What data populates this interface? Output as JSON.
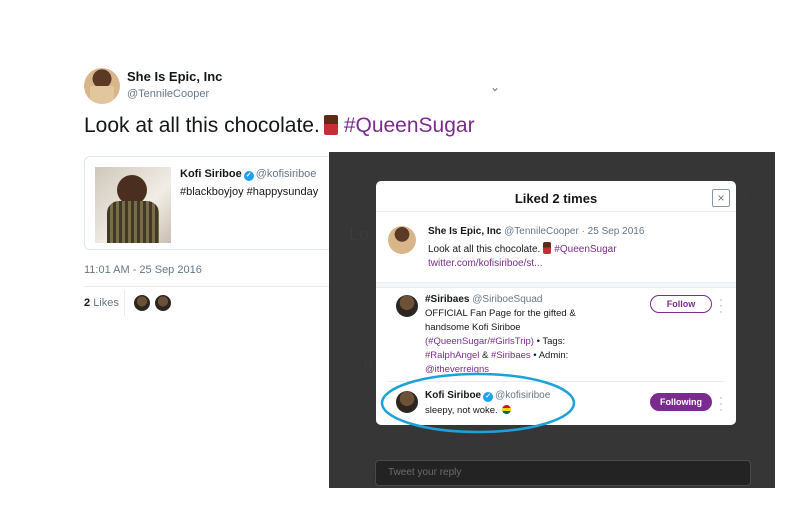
{
  "tweet": {
    "author_name": "She Is Epic, Inc",
    "author_handle": "@TennileCooper",
    "text": "Look at all this chocolate.",
    "hashtag": "#QueenSugar",
    "quote": {
      "name": "Kofi Siriboe",
      "handle": "@kofisiriboe",
      "text": "#blackboyjoy #happysunday"
    },
    "timestamp": "11:01 AM - 25 Sep 2016",
    "likes_count": "2",
    "likes_label": "Likes"
  },
  "overlay": {
    "reply_placeholder": "Tweet your reply"
  },
  "modal": {
    "title": "Liked 2 times",
    "close": "×",
    "original": {
      "name": "She Is Epic, Inc",
      "meta": "@TennileCooper · 25 Sep 2016",
      "text": "Look at all this chocolate.",
      "hashtag": "#QueenSugar",
      "link": "twitter.com/kofisiriboe/st..."
    },
    "likers": [
      {
        "name": "#Siribaes",
        "handle": "@SiriboeSquad",
        "bio_1": "OFFICIAL Fan Page for the gifted &",
        "bio_2": "handsome Kofi Siriboe",
        "bio_3_link": "(#QueenSugar/#GirlsTrip)",
        "bio_3_rest": " • Tags:",
        "bio_4_a": "#RalphAngel",
        "bio_4_mid": " & ",
        "bio_4_b": "#Siribaes",
        "bio_4_rest": " • Admin:",
        "bio_5": "@itheverreigns",
        "button": "Follow"
      },
      {
        "name": "Kofi Siriboe",
        "handle": "@kofisiriboe",
        "bio_1": "sleepy, not woke.",
        "button": "Following"
      }
    ]
  },
  "colors": {
    "accent": "#7b2b8f",
    "highlight_ellipse": "#1da1d9",
    "verified": "#1da1f2"
  }
}
